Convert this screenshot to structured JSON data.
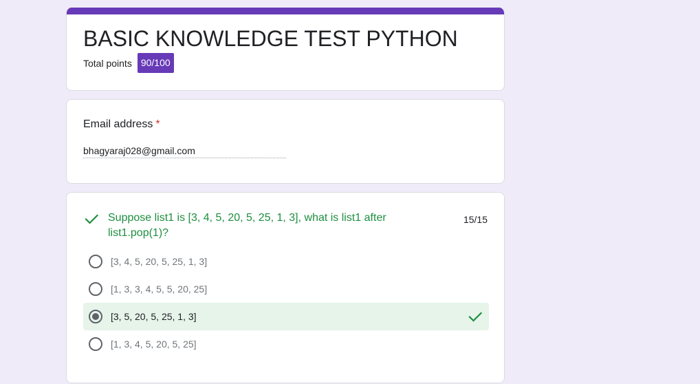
{
  "form": {
    "title": "BASIC KNOWLEDGE TEST PYTHON",
    "total_points_label": "Total points",
    "total_points_value": "90/100",
    "accent_color": "#673ab7"
  },
  "email": {
    "label": "Email address",
    "required_mark": "*",
    "value": "bhagyaraj028@gmail.com"
  },
  "question": {
    "text": "Suppose list1 is [3, 4, 5, 20, 5, 25, 1, 3], what is list1 after list1.pop(1)?",
    "score": "15/15",
    "status_icon": "check-icon",
    "options": [
      {
        "label": "[3, 4, 5, 20, 5, 25, 1, 3]",
        "selected": false,
        "correct": false
      },
      {
        "label": "[1, 3, 3, 4, 5, 5, 20, 25]",
        "selected": false,
        "correct": false
      },
      {
        "label": "[3, 5, 20, 5, 25, 1, 3]",
        "selected": true,
        "correct": true
      },
      {
        "label": "[1, 3, 4, 5, 20, 5, 25]",
        "selected": false,
        "correct": false
      }
    ],
    "correct_color": "#1e8e3e"
  }
}
